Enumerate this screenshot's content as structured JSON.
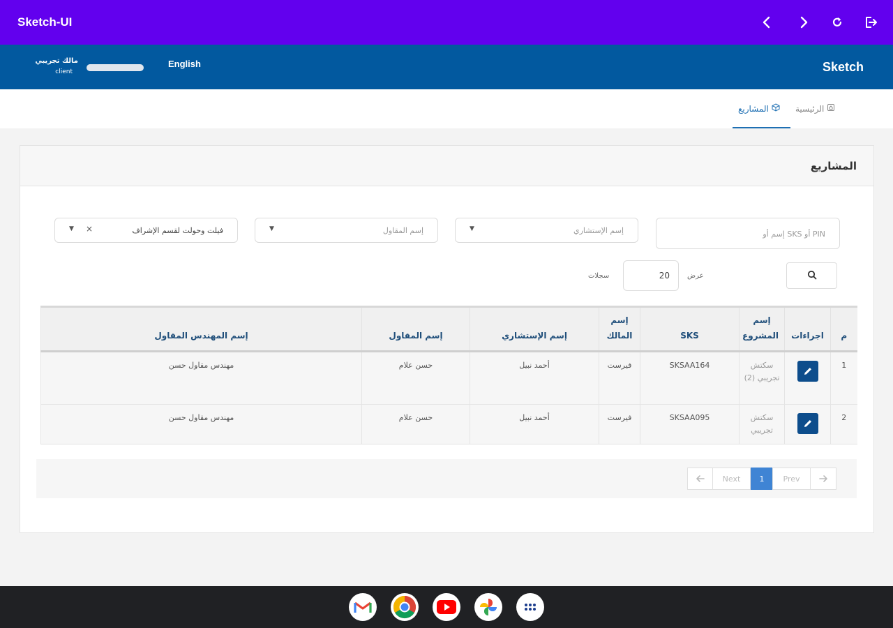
{
  "appbar": {
    "title": "Sketch-UI",
    "icons": [
      "chevron-left-icon",
      "chevron-right-icon",
      "refresh-icon",
      "logout-icon"
    ],
    "color": "#6200ee"
  },
  "header": {
    "brand": "Sketch",
    "language": "English",
    "user_name": "مالك تجريبي",
    "user_role": "client",
    "color": "#02599f"
  },
  "breadcrumb": {
    "home": "الرئيسية",
    "projects": "المشاريع"
  },
  "card": {
    "title": "المشاريع"
  },
  "filters": {
    "search_placeholder": "إسم أو SKS أو PIN",
    "consultant_placeholder": "إسم الإستشاري",
    "contractor_placeholder": "إسم المقاول",
    "type_value": "فيلت وحولت لقسم الإشراف"
  },
  "paging": {
    "show_label": "عرض",
    "page_size": "20",
    "records_label": "سجلات"
  },
  "table": {
    "headers": {
      "index": "م",
      "actions": "اجراءات",
      "project_name": "إسم المشروع",
      "sks": "SKS",
      "owner": "إسم المالك",
      "consultant": "إسم الإستشاري",
      "contractor": "إسم المقاول",
      "engineer": "إسم المهندس المقاول"
    },
    "rows": [
      {
        "index": "1",
        "project_name": "سكتش تجريبي (2)",
        "sks": "SKSAA164",
        "owner": "فيرست",
        "consultant": "أحمد نبيل",
        "contractor": "حسن علام",
        "engineer": "مهندس مقاول حسن"
      },
      {
        "index": "2",
        "project_name": "سكتش تجريبي",
        "sks": "SKSAA095",
        "owner": "فيرست",
        "consultant": "أحمد نبيل",
        "contractor": "حسن علام",
        "engineer": "مهندس مقاول حسن"
      }
    ]
  },
  "pagination": {
    "next": "Next",
    "current": "1",
    "prev": "Prev"
  },
  "dock": {
    "apps": [
      "gmail-icon",
      "chrome-icon",
      "youtube-icon",
      "photos-icon",
      "app-launcher-icon"
    ]
  }
}
